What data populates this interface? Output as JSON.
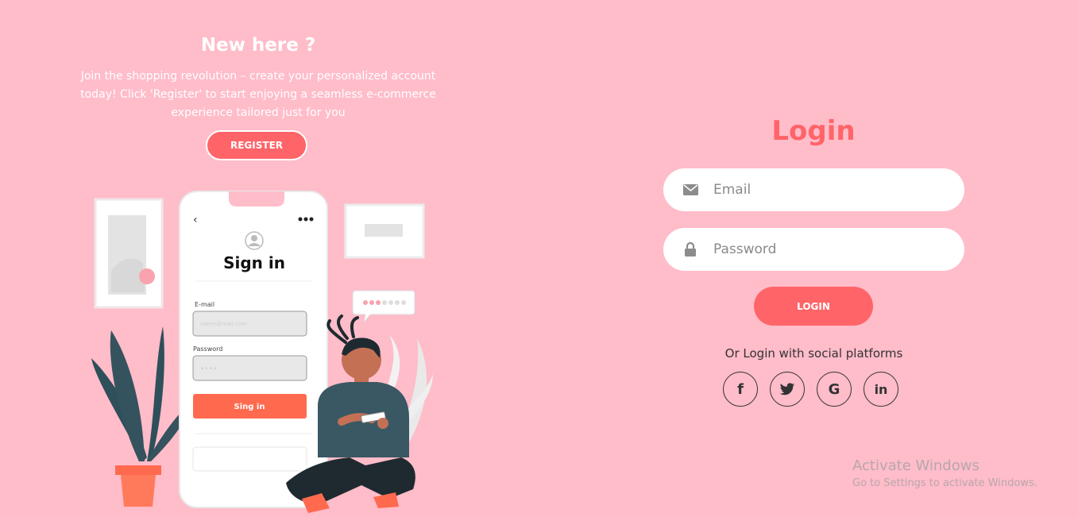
{
  "left_panel": {
    "title": "New here ?",
    "description": "Join the shopping revolution – create your personalized account today! Click 'Register' to start enjoying a seamless e-commerce experience tailored just for you",
    "register_label": "REGISTER"
  },
  "illustration": {
    "phone_title": "Sign in",
    "email_label": "E-mail",
    "email_value": "name@mail.com",
    "password_label": "Password",
    "password_value": "••••",
    "signin_button": "Sing in"
  },
  "login": {
    "title": "Login",
    "email_placeholder": "Email",
    "password_placeholder": "Password",
    "login_label": "LOGIN",
    "social_text": "Or Login with social platforms",
    "socials": [
      "f",
      "G",
      "in"
    ]
  },
  "watermark": {
    "title": "Activate Windows",
    "subtitle": "Go to Settings to activate Windows."
  },
  "colors": {
    "background": "#ffbcc9",
    "accent": "#ff6468"
  }
}
